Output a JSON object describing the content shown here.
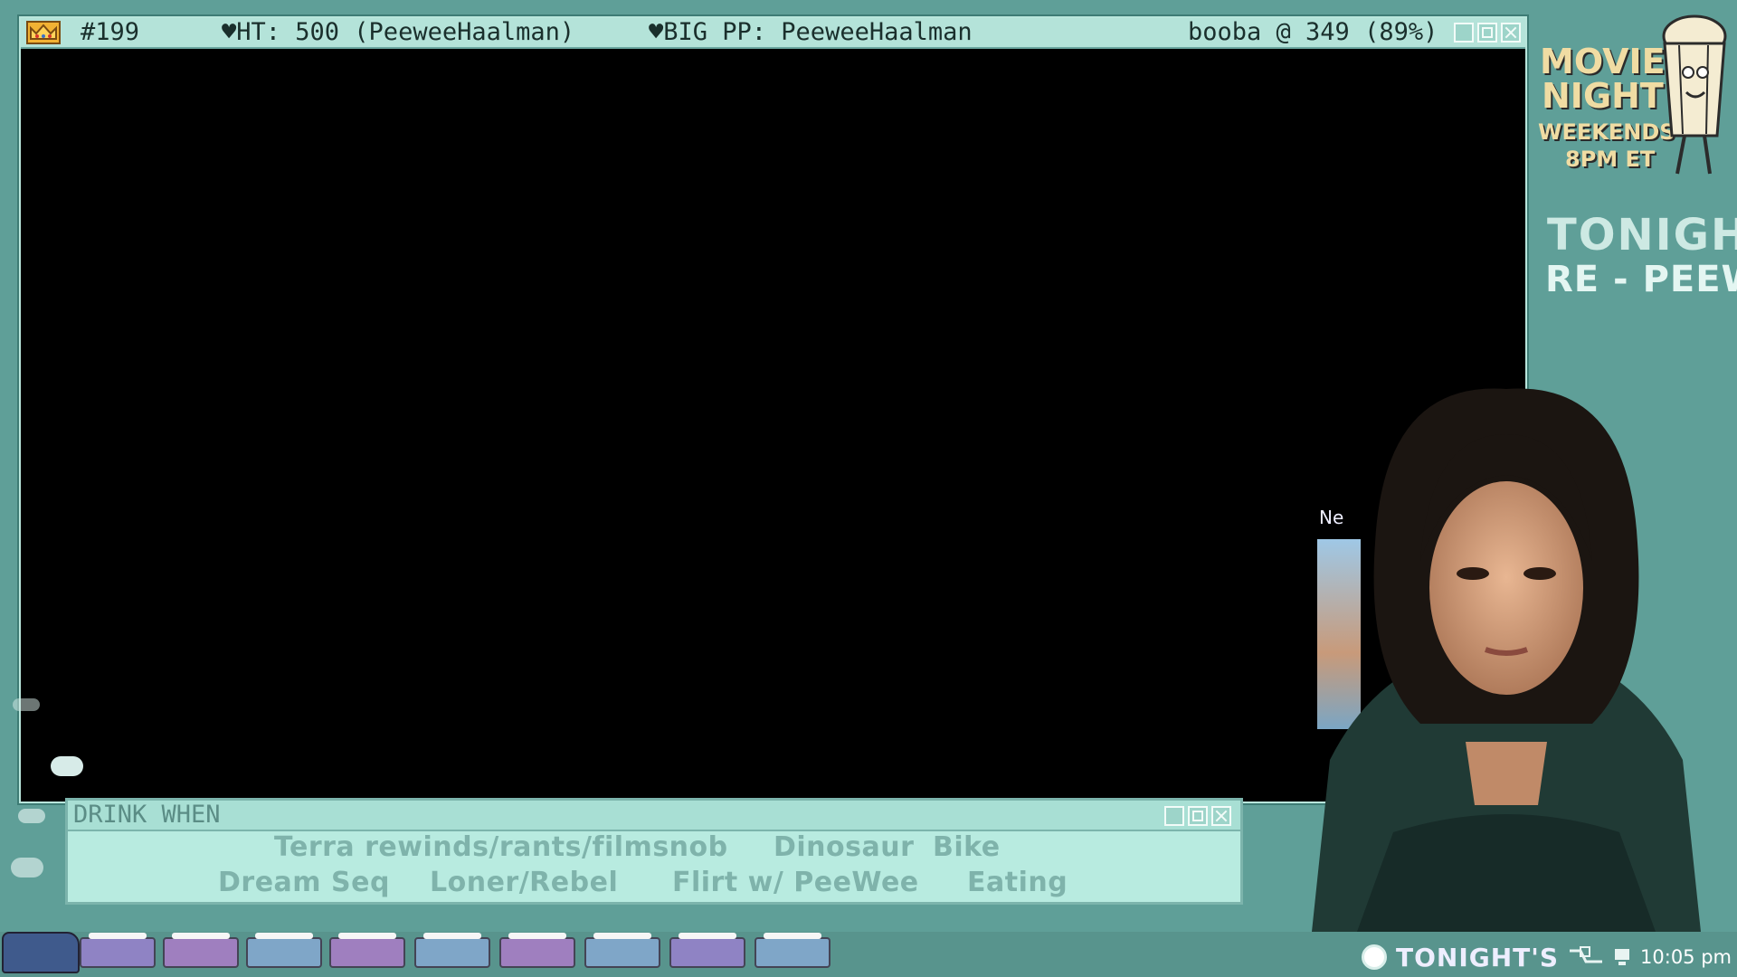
{
  "main_window": {
    "episode": "#199",
    "high_tip": "♥HT: 500 (PeeweeHaalman)",
    "big_pp": "♥BIG PP: PeeweeHaalman",
    "goal": "booba @ 349 (89%)"
  },
  "drink_when": {
    "title": "DRINK WHEN",
    "items": [
      "Terra rewinds/rants/filmsnob",
      "Dinosaur",
      "Bike",
      "Dream Seq",
      "Loner/Rebel",
      "Flirt w/ PeeWee",
      "Eating"
    ]
  },
  "branding": {
    "line1": "MOVIE",
    "line2": "NIGHT",
    "line3": "WEEKENDS",
    "line4": "8PM ET",
    "tonight": "TONIGHT:",
    "feature": "RE - PEEWEE"
  },
  "overlay": {
    "ne_label": "Ne"
  },
  "taskbar": {
    "tonight": "TONIGHT'S",
    "clock": "10:05 pm"
  },
  "colors": {
    "background": "#5f9f98",
    "titlebar": "#b4e3d9",
    "drink_text": "#7fb3ab"
  }
}
